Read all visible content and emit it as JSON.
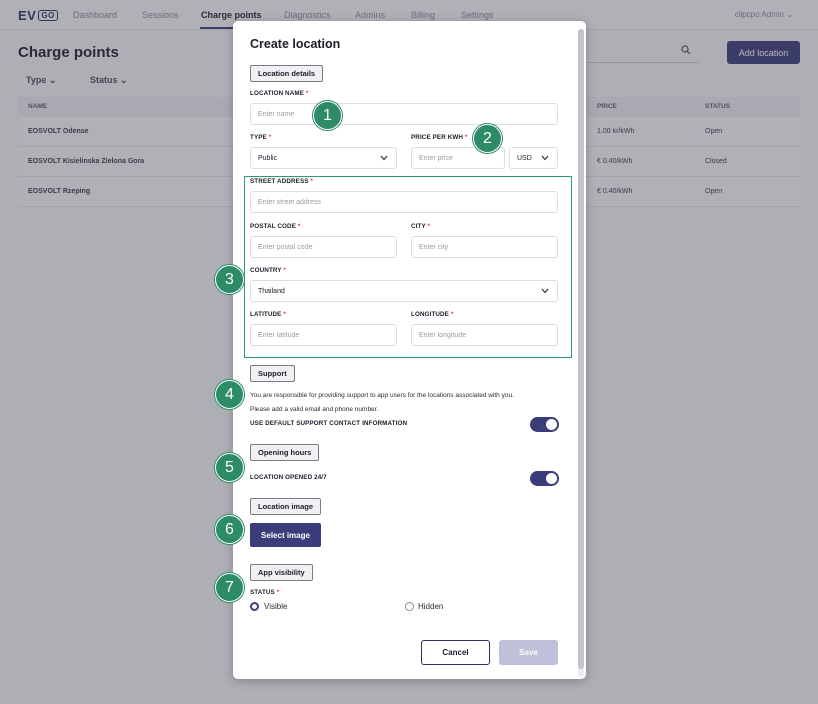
{
  "app": {
    "logo": "EV",
    "logo_badge": "GO",
    "nav": [
      "Dashboard",
      "Sessions",
      "Charge points",
      "Diagnostics",
      "Admins",
      "Billing",
      "Settings"
    ],
    "active_nav": "Charge points",
    "user": "clipcpo Admin"
  },
  "page": {
    "title": "Charge points",
    "filters": [
      "Type",
      "Status"
    ],
    "add_button": "Add location",
    "table": {
      "headers": [
        "NAME",
        "PRICE",
        "STATUS"
      ],
      "rows": [
        {
          "name": "EOSVOLT Odense",
          "price": "1.00 kr/kWh",
          "status": "Open"
        },
        {
          "name": "EOSVOLT Kisielinska Zielona Gora",
          "price": "€ 0.40/kWh",
          "status": "Closed"
        },
        {
          "name": "EOSVOLT Rzeping",
          "price": "€ 0.40/kWh",
          "status": "Open"
        }
      ]
    }
  },
  "modal": {
    "title": "Create location",
    "sections": {
      "details": "Location details",
      "support": "Support",
      "opening": "Opening hours",
      "image": "Location image",
      "visibility": "App visibility"
    },
    "fields": {
      "location_name": {
        "label": "LOCATION NAME",
        "placeholder": "Enter name"
      },
      "type": {
        "label": "TYPE",
        "value": "Public"
      },
      "price": {
        "label": "PRICE PER KWH",
        "placeholder": "Enter price",
        "currency": "USD"
      },
      "street": {
        "label": "STREET ADDRESS",
        "placeholder": "Enter street address"
      },
      "postal": {
        "label": "POSTAL CODE",
        "placeholder": "Enter postal code"
      },
      "city": {
        "label": "CITY",
        "placeholder": "Enter city"
      },
      "country": {
        "label": "COUNTRY",
        "value": "Thailand"
      },
      "latitude": {
        "label": "LATITUDE",
        "placeholder": "Enter latitude"
      },
      "longitude": {
        "label": "LONGITUDE",
        "placeholder": "Enter longitude"
      }
    },
    "support_text_1": "You are responsible for providing support to app users for the locations associated with you.",
    "support_text_2": "Please add a valid email and phone number.",
    "support_toggle_label": "USE DEFAULT SUPPORT CONTACT INFORMATION",
    "support_toggle_on": true,
    "opening_toggle_label": "LOCATION OPENED 24/7",
    "opening_toggle_on": true,
    "select_image": "Select image",
    "status_label": "STATUS",
    "status_options": [
      "Visible",
      "Hidden"
    ],
    "status_selected": "Visible",
    "cancel": "Cancel",
    "save": "Save",
    "required_mark": "*"
  },
  "markers": [
    "1",
    "2",
    "3",
    "4",
    "5",
    "6",
    "7"
  ],
  "colors": {
    "primary": "#3b3d7a",
    "marker": "#2e8b68",
    "required": "#e0394e"
  }
}
